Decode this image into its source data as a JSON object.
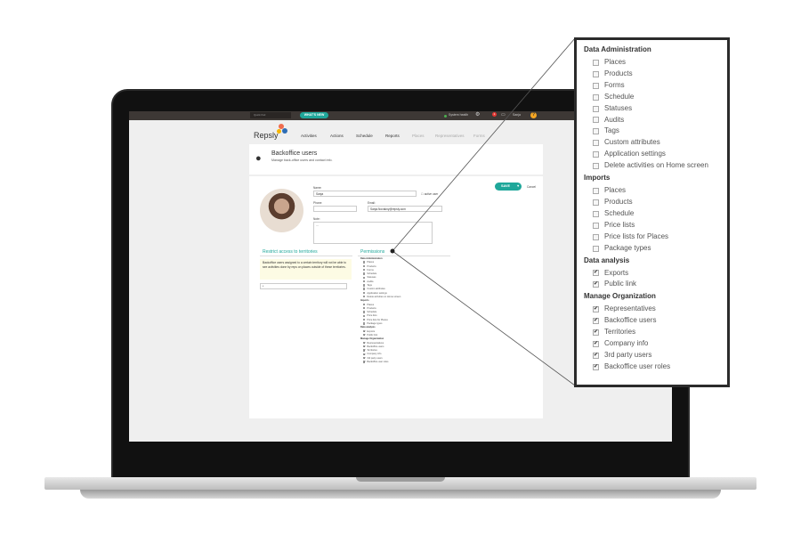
{
  "topbar": {
    "search_placeholder": "Quick find",
    "whats_new": "WHAT'S NEW",
    "system_health": "System health",
    "notifications": "1",
    "user": "Sanja",
    "help": "?"
  },
  "nav": {
    "logo": "Repsly",
    "items": [
      "Activities",
      "Actions",
      "Schedule",
      "Reports",
      "Places",
      "Representatives",
      "Forms"
    ]
  },
  "header": {
    "title": "Backoffice users",
    "subtitle": "Manage back-office users and contact info."
  },
  "form": {
    "name_label": "Name:",
    "name_value": "Sanja",
    "active_label": "active user",
    "phone_label": "Phone:",
    "phone_value": "",
    "email_label": "Email:",
    "email_value": "Sanja.Novakny@repsly.com",
    "note_label": "Note:",
    "note_value": "...",
    "save": "SAVE",
    "cancel": "Cancel"
  },
  "territories": {
    "title": "Restrict access to territories",
    "notice": "Backoffice users assigned to a certain territory will not be able to see activities done by reps on places outside of these territories.",
    "select_value": "*"
  },
  "permissions": {
    "title": "Permissions",
    "groups": [
      {
        "name": "Data Administration",
        "items": [
          {
            "label": "Places",
            "checked": false
          },
          {
            "label": "Products",
            "checked": false
          },
          {
            "label": "Forms",
            "checked": false
          },
          {
            "label": "Schedule",
            "checked": false
          },
          {
            "label": "Statuses",
            "checked": false
          },
          {
            "label": "Audits",
            "checked": false
          },
          {
            "label": "Tags",
            "checked": false
          },
          {
            "label": "Custom attributes",
            "checked": false
          },
          {
            "label": "Application settings",
            "checked": false
          },
          {
            "label": "Delete activities on Home screen",
            "checked": false
          }
        ]
      },
      {
        "name": "Imports",
        "items": [
          {
            "label": "Places",
            "checked": false
          },
          {
            "label": "Products",
            "checked": false
          },
          {
            "label": "Schedule",
            "checked": false
          },
          {
            "label": "Price lists",
            "checked": false
          },
          {
            "label": "Price lists for Places",
            "checked": false
          },
          {
            "label": "Package types",
            "checked": false
          }
        ]
      },
      {
        "name": "Data analysis",
        "items": [
          {
            "label": "Exports",
            "checked": true
          },
          {
            "label": "Public link",
            "checked": true
          }
        ]
      },
      {
        "name": "Manage Organization",
        "items": [
          {
            "label": "Representatives",
            "checked": true
          },
          {
            "label": "Backoffice users",
            "checked": true
          },
          {
            "label": "Territories",
            "checked": true
          },
          {
            "label": "Company info",
            "checked": true
          },
          {
            "label": "3rd party users",
            "checked": true
          },
          {
            "label": "Backoffice user roles",
            "checked": true
          }
        ]
      }
    ]
  }
}
